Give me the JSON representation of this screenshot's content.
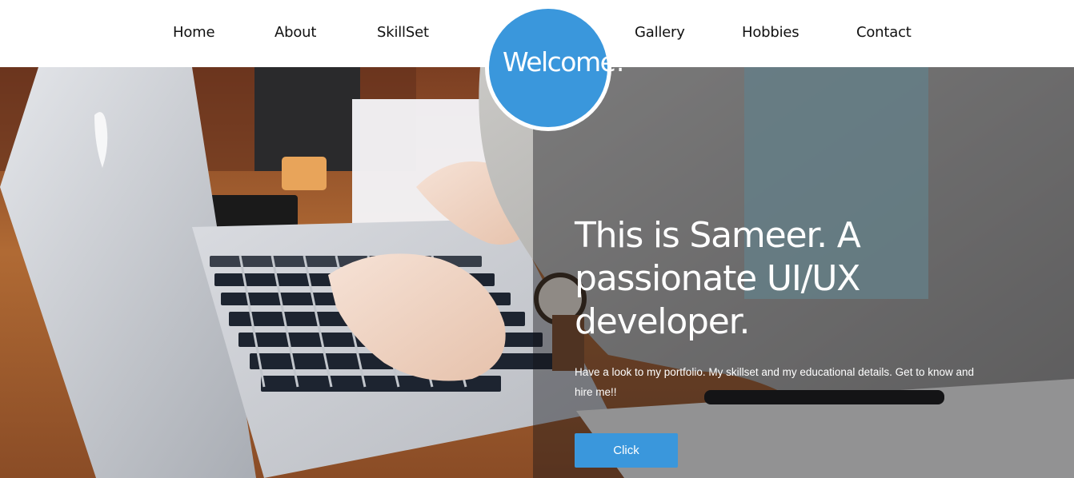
{
  "nav": {
    "items": [
      {
        "label": "Home"
      },
      {
        "label": "About"
      },
      {
        "label": "SkillSet"
      },
      {
        "label": "Gallery"
      },
      {
        "label": "Hobbies"
      },
      {
        "label": "Contact"
      }
    ]
  },
  "welcome": {
    "label": "Welcome!"
  },
  "hero": {
    "headline": "This is Sameer. A passionate UI/UX developer.",
    "subtext": "Have a look to my portfolio. My skillset and my educational details. Get to know and hire me!!",
    "button_label": "Click"
  },
  "colors": {
    "accent": "#3a97dc",
    "nav_background": "#ffffff",
    "nav_text": "#111111",
    "hero_text": "#ffffff"
  },
  "icons": {
    "hero_image": "laptop-typing-photo"
  }
}
